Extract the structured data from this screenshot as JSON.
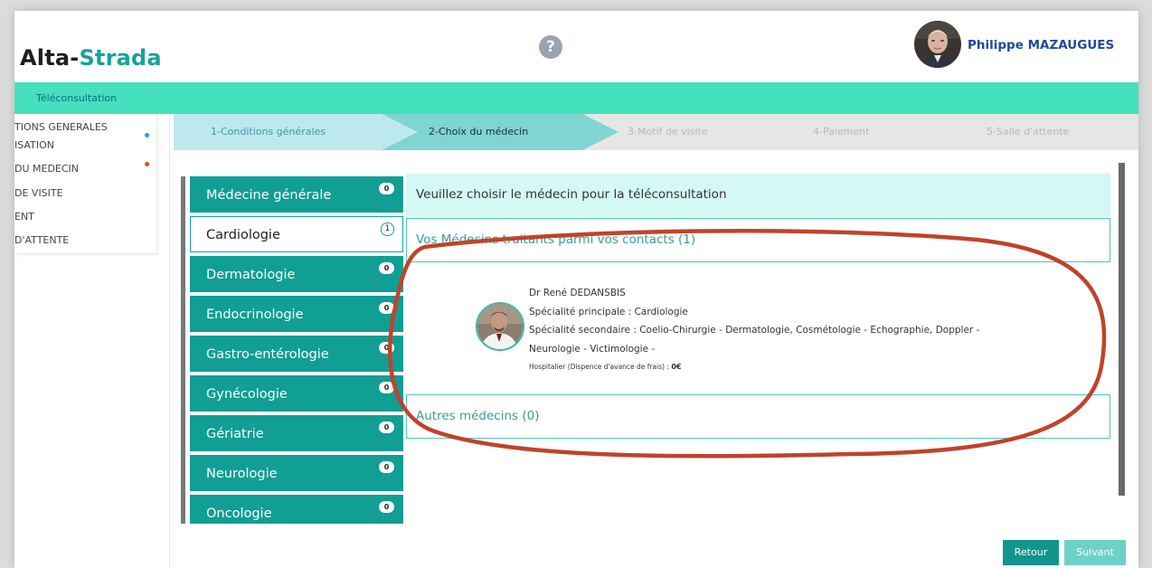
{
  "header": {
    "logo_part1": "Alta-",
    "logo_part2": "Strada",
    "help_glyph": "?",
    "user_name": "Philippe MAZAUGUES"
  },
  "nav": {
    "title": "Téléconsultation"
  },
  "sidebar": {
    "items": [
      {
        "label": "TIONS GENERALES",
        "dot_color": "#1aa3e8"
      },
      {
        "label": "ISATION"
      },
      {
        "label": "DU MEDECIN",
        "dot_color": "#e04a1a"
      },
      {
        "label": "DE VISITE"
      },
      {
        "label": "ENT"
      },
      {
        "label": "D'ATTENTE"
      }
    ]
  },
  "steps": [
    {
      "label": "1-Conditions générales",
      "state": "done"
    },
    {
      "label": "2-Choix du médecin",
      "state": "active"
    },
    {
      "label": "3-Motif de visite",
      "state": "todo"
    },
    {
      "label": "4-Paiement",
      "state": "todo"
    },
    {
      "label": "5-Salle d'attente",
      "state": "todo"
    }
  ],
  "specialties": [
    {
      "label": "Médecine générale",
      "count": "0",
      "selected": false
    },
    {
      "label": "Cardiologie",
      "count": "1",
      "selected": true
    },
    {
      "label": "Dermatologie",
      "count": "0",
      "selected": false
    },
    {
      "label": "Endocrinologie",
      "count": "0",
      "selected": false
    },
    {
      "label": "Gastro-entérologie",
      "count": "0",
      "selected": false
    },
    {
      "label": "Gynécologie",
      "count": "0",
      "selected": false
    },
    {
      "label": "Gériatrie",
      "count": "0",
      "selected": false
    },
    {
      "label": "Neurologie",
      "count": "0",
      "selected": false
    },
    {
      "label": "Oncologie",
      "count": "0",
      "selected": false
    }
  ],
  "main": {
    "header": "Veuillez choisir le médecin pour la téléconsultation",
    "treating_section": "Vos Médecins traitants parmi vos contacts (1)",
    "other_section": "Autres médecins (0)"
  },
  "doctor": {
    "name": "Dr René DEDANSBIS",
    "primary": "Spécialité principale : Cardiologie",
    "secondary_line1": "Spécialité secondaire : Coelio-Chirurgie - Dermatologie, Cosmétologie - Echographie, Doppler -",
    "secondary_line2": "Neurologie - Victimologie -",
    "fee_label": "Hospitalier (Dispence d'avance de frais) : ",
    "fee_value": "0€"
  },
  "buttons": {
    "back": "Retour",
    "next": "Suivant"
  },
  "colors": {
    "brand": "#16a396",
    "nav": "#45e0bd",
    "specialty": "#119e94",
    "highlight_oval": "#c0432a",
    "user_name": "#1f4aa0"
  },
  "icons": {
    "help": "help-icon",
    "user_avatar": "avatar"
  }
}
